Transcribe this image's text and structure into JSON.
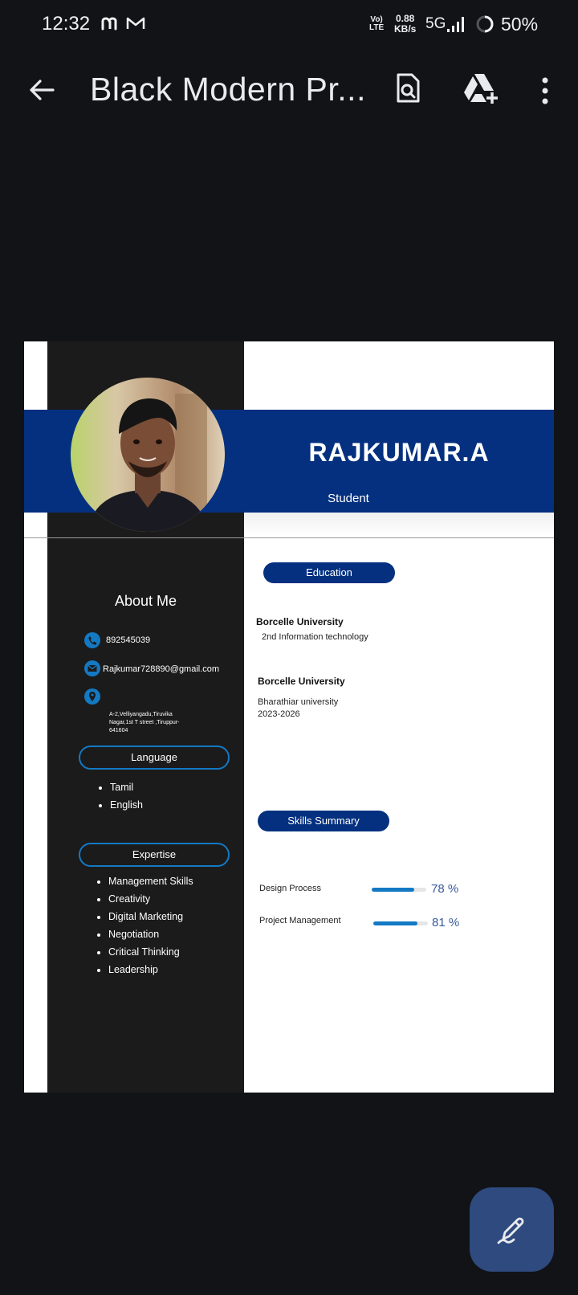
{
  "status_bar": {
    "time": "12:32",
    "volte_top": "Vo)",
    "volte_bottom": "LTE",
    "speed_value": "0.88",
    "speed_unit": "KB/s",
    "network": "5G",
    "battery": "50%"
  },
  "app_bar": {
    "title": "Black Modern Pr..."
  },
  "resume": {
    "name": "RAJKUMAR.A",
    "role": "Student",
    "about_heading": "About Me",
    "phone": "892545039",
    "email": "Rajkumar728890@gmail.com",
    "address": "A-2,Velliyangadu,Tiruvika Nagar,1st T street ,Tiruppur-641604",
    "language_heading": "Language",
    "languages": [
      "Tamil",
      "English"
    ],
    "expertise_heading": "Expertise",
    "expertise": [
      "Management Skills",
      "Creativity",
      "Digital Marketing",
      "Negotiation",
      "Critical Thinking",
      "Leadership"
    ],
    "education_heading": "Education",
    "education": [
      {
        "school": "Borcelle University",
        "line1": "2nd Information technology",
        "line2": ""
      },
      {
        "school": "Borcelle University",
        "line1": "Bharathiar university",
        "line2": "2023-2026"
      }
    ],
    "skills_heading": "Skills Summary",
    "skills": [
      {
        "name": "Design Process",
        "percent": 78,
        "label": "78 %"
      },
      {
        "name": "Project Management",
        "percent": 81,
        "label": "81 %"
      }
    ]
  },
  "colors": {
    "banner": "#04307f",
    "sidebar": "#1b1b1b",
    "accent": "#1479c3",
    "fab": "#2e4a7e",
    "background": "#121317"
  },
  "icons": [
    "back-arrow-icon",
    "find-in-page-icon",
    "add-to-drive-icon",
    "more-vert-icon",
    "phone-icon",
    "mail-icon",
    "location-pin-icon",
    "edit-pen-icon"
  ]
}
